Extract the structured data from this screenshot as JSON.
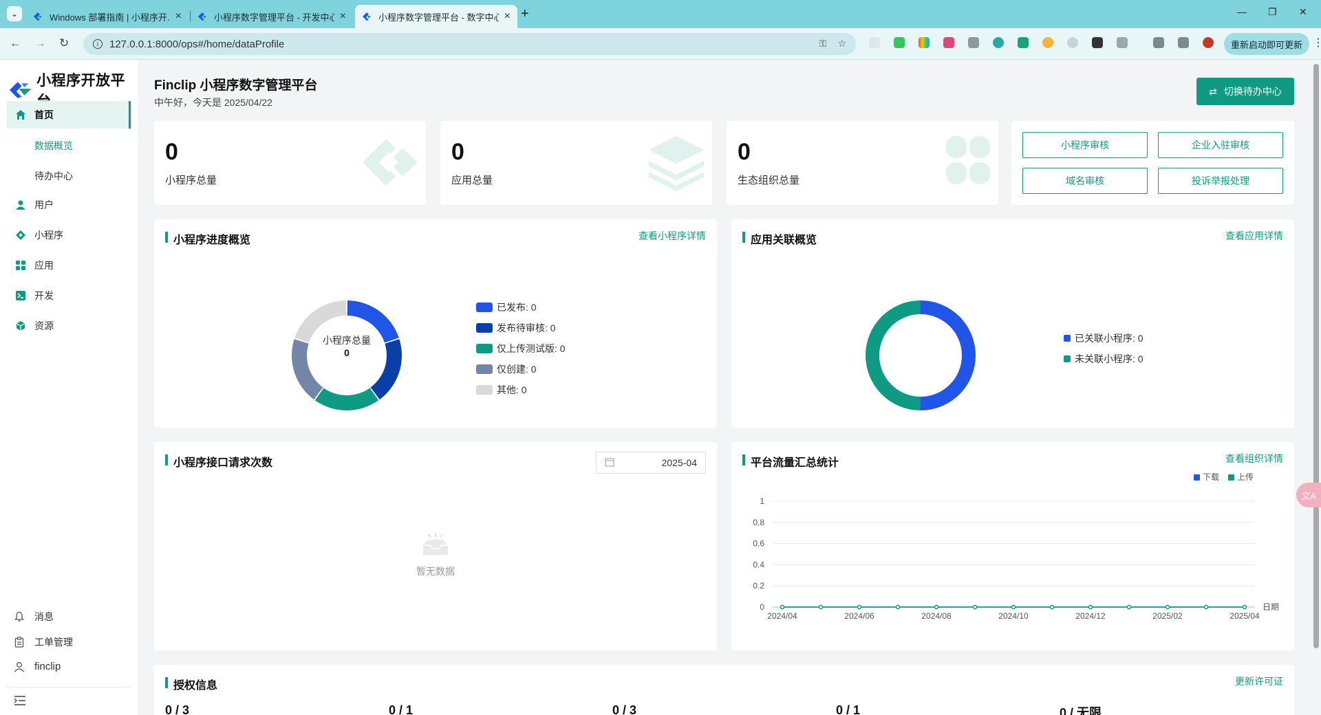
{
  "browser": {
    "tabs": [
      {
        "title": "Windows 部署指南 | 小程序开..."
      },
      {
        "title": "小程序数字管理平台 - 开发中心..."
      },
      {
        "title": "小程序数字管理平台 - 数字中心..."
      }
    ],
    "url": "127.0.0.1:8000/ops#/home/dataProfile",
    "relaunch_label": "重新启动即可更新"
  },
  "sidebar": {
    "logo_text": "小程序开放平台",
    "items": [
      {
        "label": "首页",
        "icon": "home-icon"
      },
      {
        "label": "用户",
        "icon": "user-icon"
      },
      {
        "label": "小程序",
        "icon": "miniprogram-icon"
      },
      {
        "label": "应用",
        "icon": "apps-icon"
      },
      {
        "label": "开发",
        "icon": "terminal-icon"
      },
      {
        "label": "资源",
        "icon": "resource-icon"
      }
    ],
    "sub_items": [
      {
        "label": "数据概览"
      },
      {
        "label": "待办中心"
      }
    ],
    "bottom": [
      {
        "label": "消息",
        "icon": "bell-icon"
      },
      {
        "label": "工单管理",
        "icon": "clipboard-icon"
      },
      {
        "label": "finclip",
        "icon": "person-icon"
      }
    ]
  },
  "header": {
    "title": "Finclip 小程序数字管理平台",
    "greeting": "中午好，今天是 2025/04/22",
    "switch_label": "切换待办中心"
  },
  "stats": [
    {
      "value": "0",
      "label": "小程序总量"
    },
    {
      "value": "0",
      "label": "应用总量"
    },
    {
      "value": "0",
      "label": "生态组织总量"
    }
  ],
  "audit_buttons": [
    {
      "label": "小程序审核"
    },
    {
      "label": "企业入驻审核"
    },
    {
      "label": "域名审核"
    },
    {
      "label": "投诉举报处理"
    }
  ],
  "progress_panel": {
    "title": "小程序进度概览",
    "link": "查看小程序详情",
    "center_label": "小程序总量",
    "center_value": "0",
    "legend": [
      {
        "label": "已发布: 0",
        "color": "#2155e8"
      },
      {
        "label": "发布待审核: 0",
        "color": "#0b3fa8"
      },
      {
        "label": "仅上传测试版: 0",
        "color": "#0f9b83"
      },
      {
        "label": "仅创建: 0",
        "color": "#7486a8"
      },
      {
        "label": "其他: 0",
        "color": "#d9d9d9"
      }
    ]
  },
  "assoc_panel": {
    "title": "应用关联概览",
    "link": "查看应用详情",
    "legend": [
      {
        "label": "已关联小程序: 0",
        "color": "#2155e8"
      },
      {
        "label": "未关联小程序: 0",
        "color": "#0f9b83"
      }
    ]
  },
  "api_panel": {
    "title": "小程序接口请求次数",
    "date": "2025-04",
    "empty_text": "暂无数据"
  },
  "traffic_panel": {
    "title": "平台流量汇总统计",
    "link": "查看组织详情"
  },
  "license_panel": {
    "title": "授权信息",
    "link": "更新许可证",
    "values": [
      "0 / 3",
      "0 / 1",
      "0 / 3",
      "0 / 1",
      "0 / 无限"
    ]
  },
  "chart_data": {
    "type": "line",
    "title": "",
    "xlabel": "日期",
    "ylabel": "",
    "ylim": [
      0,
      1
    ],
    "yticks": [
      "0",
      "0.2",
      "0.4",
      "0.6",
      "0.8",
      "1"
    ],
    "x": [
      "2024/04",
      "2024/05",
      "2024/06",
      "2024/07",
      "2024/08",
      "2024/09",
      "2024/10",
      "2024/11",
      "2024/12",
      "2025/01",
      "2025/02",
      "2025/03",
      "2025/04"
    ],
    "xtick_labels": [
      "2024/04",
      "2024/06",
      "2024/08",
      "2024/10",
      "2024/12",
      "2025/02",
      "2025/04"
    ],
    "legend_position": "top-right",
    "series": [
      {
        "name": "下载",
        "color": "#2155e8",
        "values": [
          0,
          0,
          0,
          0,
          0,
          0,
          0,
          0,
          0,
          0,
          0,
          0,
          0
        ]
      },
      {
        "name": "上传",
        "color": "#0f9b83",
        "values": [
          0,
          0,
          0,
          0,
          0,
          0,
          0,
          0,
          0,
          0,
          0,
          0,
          0
        ]
      }
    ]
  }
}
